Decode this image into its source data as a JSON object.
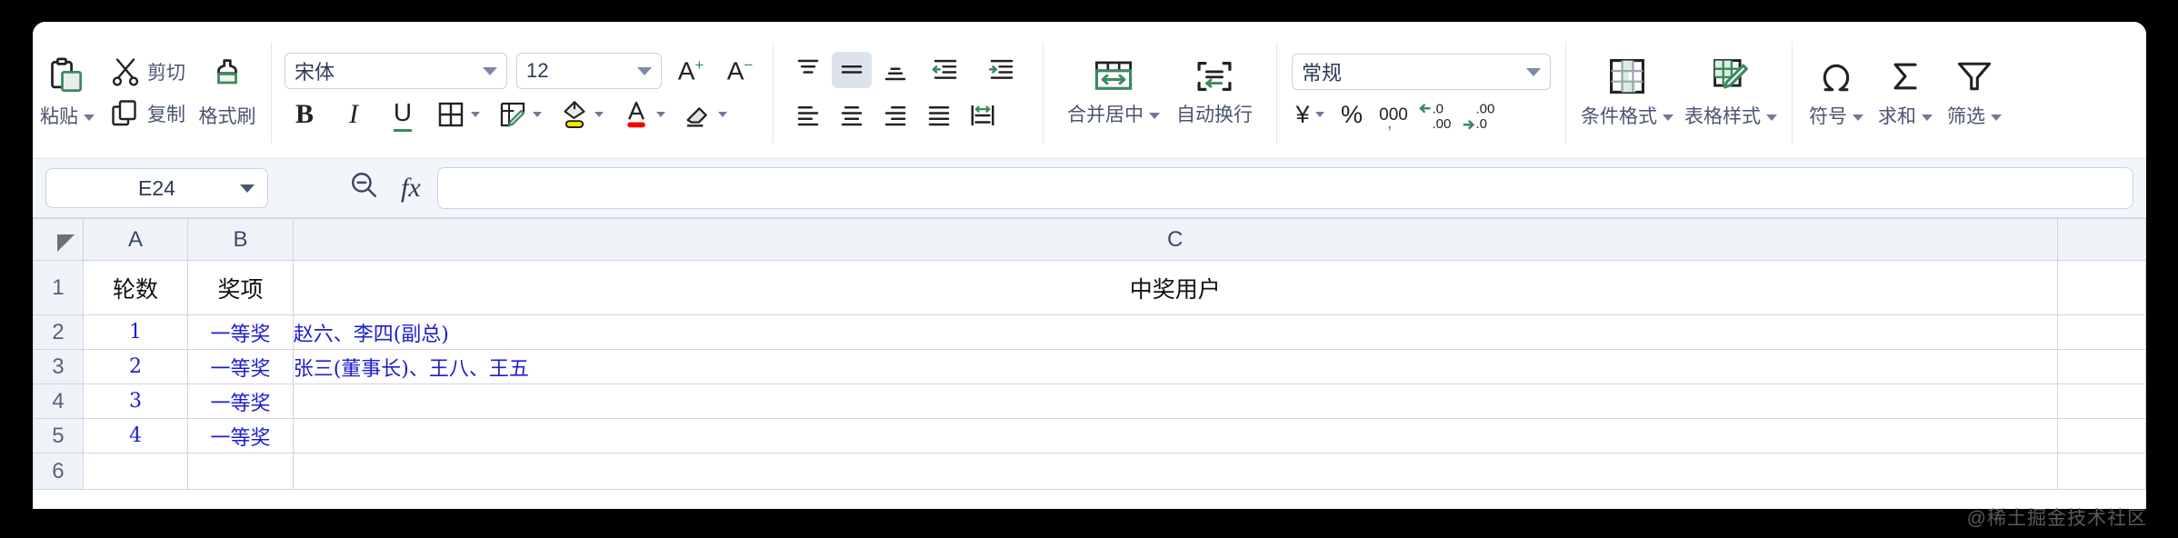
{
  "ribbon": {
    "clipboard": {
      "paste_label": "粘贴",
      "cut_label": "剪切",
      "copy_label": "复制",
      "format_painter_label": "格式刷"
    },
    "font": {
      "family_value": "宋体",
      "size_value": "12",
      "grow_label": "A",
      "shrink_label": "A",
      "bold_label": "B",
      "italic_label": "I",
      "underline_label": "U"
    },
    "alignment": {
      "merge_label": "合并居中",
      "wrap_label": "自动换行"
    },
    "number": {
      "format_value": "常规",
      "currency_label": "¥",
      "percent_label": "%",
      "comma_label": "000"
    },
    "styles": {
      "conditional_label": "条件格式",
      "table_style_label": "表格样式"
    },
    "tools": {
      "symbol_label": "符号",
      "sum_label": "求和",
      "filter_label": "筛选"
    }
  },
  "formula_bar": {
    "name_box_value": "E24",
    "fx_label": "fx",
    "formula_value": ""
  },
  "sheet": {
    "columns": [
      "A",
      "B",
      "C"
    ],
    "row_numbers": [
      "1",
      "2",
      "3",
      "4",
      "5",
      "6"
    ],
    "header_row": {
      "a": "轮数",
      "b": "奖项",
      "c": "中奖用户"
    },
    "rows": [
      {
        "num": "2",
        "a": "1",
        "b": "一等奖",
        "c": "赵六、李四(副总)"
      },
      {
        "num": "3",
        "a": "2",
        "b": "一等奖",
        "c": "张三(董事长)、王八、王五"
      },
      {
        "num": "4",
        "a": "3",
        "b": "一等奖",
        "c": ""
      },
      {
        "num": "5",
        "a": "4",
        "b": "一等奖",
        "c": ""
      },
      {
        "num": "6",
        "a": "",
        "b": "",
        "c": ""
      }
    ]
  },
  "watermark": {
    "text": "@稀土掘金技术社区"
  },
  "colors": {
    "fill_cyan": "#00ffff",
    "text_blue": "#1d1dd0",
    "accent_green": "#3c8a5e",
    "highlight_yellow": "#ffe400",
    "font_color_red": "#ff0000"
  }
}
